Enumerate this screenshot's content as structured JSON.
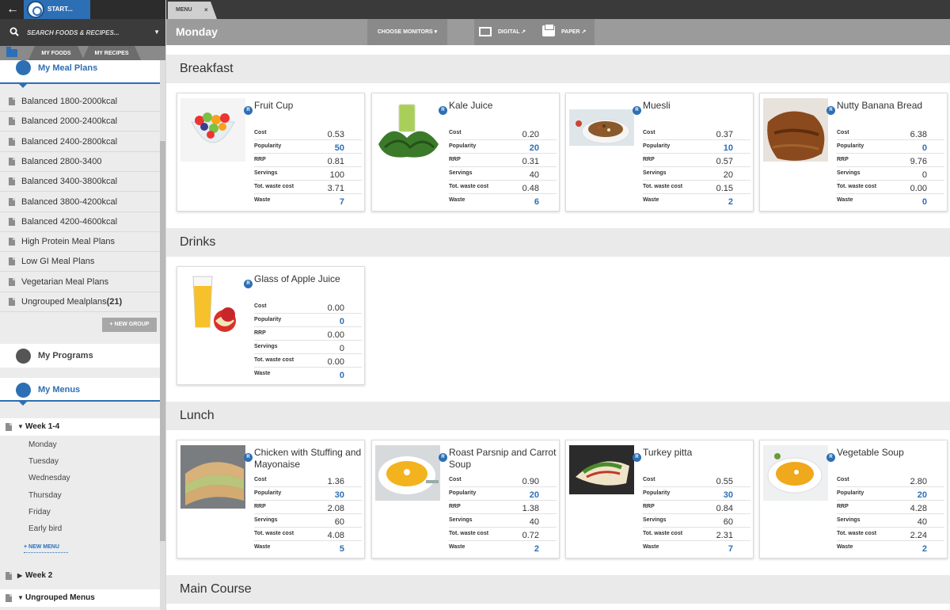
{
  "topbar": {
    "back_icon": "back-arrow-icon",
    "start_label": "START..."
  },
  "search": {
    "placeholder": "SEARCH FOODS & RECIPES..."
  },
  "sidebar_tabs": {
    "my_foods": "MY FOODS",
    "my_recipes": "MY RECIPES"
  },
  "meal_plans": {
    "title": "My Meal Plans",
    "items": [
      "Balanced 1800-2000kcal",
      "Balanced 2000-2400kcal",
      "Balanced 2400-2800kcal",
      "Balanced 2800-3400",
      "Balanced 3400-3800kcal",
      "Balanced 3800-4200kcal",
      "Balanced 4200-4600kcal",
      "High Protein Meal Plans",
      "Low GI Meal Plans",
      "Vegetarian Meal Plans"
    ],
    "ungrouped_label": "Ungrouped Mealplans",
    "ungrouped_count": "(21)",
    "new_group": "+ NEW GROUP"
  },
  "programs": {
    "title": "My Programs"
  },
  "menus": {
    "title": "My Menus",
    "group1": "Week 1-4",
    "days": [
      "Monday",
      "Tuesday",
      "Wednesday",
      "Thursday",
      "Friday",
      "Early bird"
    ],
    "new_menu": "+ NEW MENU",
    "group2": "Week 2",
    "group3": "Ungrouped Menus"
  },
  "tab": {
    "label": "MENU",
    "close": "×"
  },
  "toolbar": {
    "day": "Monday",
    "choose_monitors": "CHOOSE MONITORS ▾",
    "digital": "DIGITAL ↗",
    "paper": "PAPER ↗"
  },
  "field_labels": {
    "cost": "Cost",
    "popularity": "Popularity",
    "rrp": "RRP",
    "servings": "Servings",
    "waste_cost": "Tot. waste cost",
    "waste": "Waste"
  },
  "recipe_badge": "R",
  "categories": [
    {
      "name": "Breakfast",
      "items": [
        {
          "name": "Fruit Cup",
          "cost": "0.53",
          "popularity": "50",
          "rrp": "0.81",
          "servings": "100",
          "waste_cost": "3.71",
          "waste": "7"
        },
        {
          "name": "Kale Juice",
          "cost": "0.20",
          "popularity": "20",
          "rrp": "0.31",
          "servings": "40",
          "waste_cost": "0.48",
          "waste": "6"
        },
        {
          "name": "Muesli",
          "cost": "0.37",
          "popularity": "10",
          "rrp": "0.57",
          "servings": "20",
          "waste_cost": "0.15",
          "waste": "2"
        },
        {
          "name": "Nutty Banana Bread",
          "cost": "6.38",
          "popularity": "0",
          "rrp": "9.76",
          "servings": "0",
          "waste_cost": "0.00",
          "waste": "0"
        }
      ]
    },
    {
      "name": "Drinks",
      "items": [
        {
          "name": "Glass of Apple Juice",
          "cost": "0.00",
          "popularity": "0",
          "rrp": "0.00",
          "servings": "0",
          "waste_cost": "0.00",
          "waste": "0"
        }
      ]
    },
    {
      "name": "Lunch",
      "items": [
        {
          "name": "Chicken with Stuffing and Mayonaise",
          "cost": "1.36",
          "popularity": "30",
          "rrp": "2.08",
          "servings": "60",
          "waste_cost": "4.08",
          "waste": "5"
        },
        {
          "name": "Roast Parsnip and Carrot Soup",
          "cost": "0.90",
          "popularity": "20",
          "rrp": "1.38",
          "servings": "40",
          "waste_cost": "0.72",
          "waste": "2"
        },
        {
          "name": "Turkey pitta",
          "cost": "0.55",
          "popularity": "30",
          "rrp": "0.84",
          "servings": "60",
          "waste_cost": "2.31",
          "waste": "7"
        },
        {
          "name": "Vegetable Soup",
          "cost": "2.80",
          "popularity": "20",
          "rrp": "4.28",
          "servings": "40",
          "waste_cost": "2.24",
          "waste": "2"
        }
      ]
    },
    {
      "name": "Main Course",
      "items": []
    }
  ],
  "colors": {
    "accent": "#2d6fb5",
    "topbar": "#2c2c2c",
    "toolbar": "#9b9b9b"
  }
}
